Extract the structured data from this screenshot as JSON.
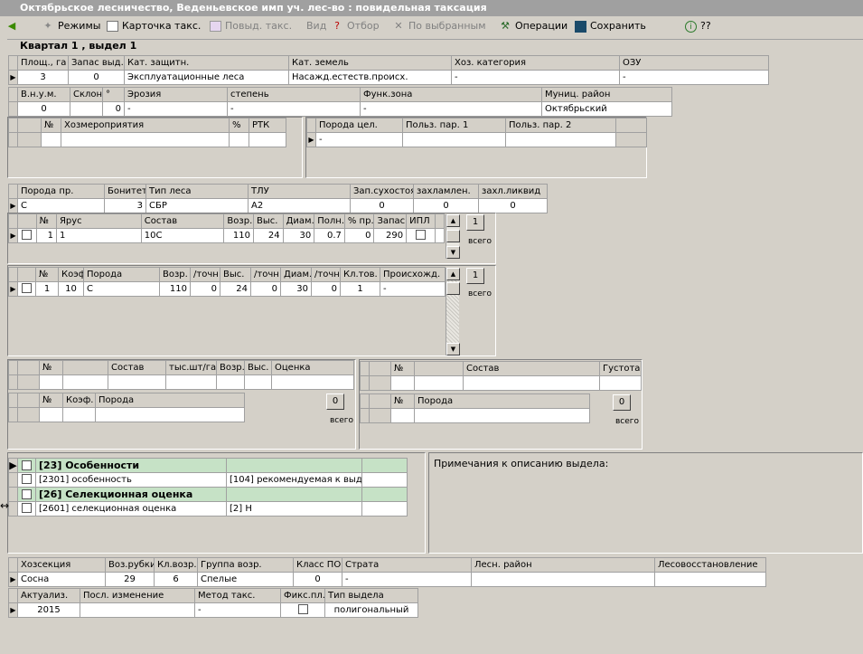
{
  "window": {
    "title": "Октябрьское лесничество, Веденьевское имп уч. лес-во : повидельная таксация"
  },
  "toolbar": {
    "rezhimy": "Режимы",
    "kartochka": "Карточка такс.",
    "povid": "Повыд. такс.",
    "vid": "Вид",
    "otbor": "Отбор",
    "po_vybrannym": "По выбранным",
    "operacii": "Операции",
    "sohranit": "Сохранить",
    "help": "??"
  },
  "quarter_label": "Квартал 1 , выдел 1",
  "grid1": {
    "headers": [
      "Площ., га",
      "Запас выд.",
      "Кат. защитн.",
      "Кат. земель",
      "Хоз. категория",
      "ОЗУ"
    ],
    "row": [
      "3",
      "0",
      "Эксплуатационные леса",
      "Насажд.естеств.происх.",
      "-",
      "-"
    ]
  },
  "grid2": {
    "headers": [
      "В.н.у.м.",
      "Склон",
      "°",
      "Эрозия",
      "степень",
      "Функ.зона",
      "Муниц. район"
    ],
    "row": [
      "0",
      "",
      "0",
      "-",
      "-",
      "-",
      "Октябрьский"
    ]
  },
  "grid3": {
    "headers": [
      "№",
      "Хозмероприятия",
      "%",
      "РТК"
    ]
  },
  "grid4": {
    "headers": [
      "Порода цел.",
      "Польз. пар. 1",
      "Польз. пар. 2"
    ],
    "row": [
      "-",
      "",
      ""
    ]
  },
  "grid5": {
    "headers": [
      "Порода пр.",
      "Бонитет",
      "Тип леса",
      "ТЛУ",
      "Зап.сухостоя",
      "захламлен.",
      "захл.ликвид"
    ],
    "row": [
      "С",
      "3",
      "СБР",
      "А2",
      "0",
      "0",
      "0"
    ]
  },
  "grid6": {
    "headers": [
      "№",
      "Ярус",
      "Состав",
      "Возр.",
      "Выс.",
      "Диам.",
      "Полн.",
      "% пр.",
      "Запас",
      "ИПЛ"
    ],
    "row": [
      "1",
      "1",
      "10С",
      "110",
      "24",
      "30",
      "0.7",
      "0",
      "290",
      ""
    ],
    "count": "1",
    "count_label": "всего"
  },
  "grid7": {
    "headers": [
      "№",
      "Коэф.",
      "Порода",
      "Возр.",
      "/точн",
      "Выс.",
      "/точн",
      "Диам.",
      "/точн",
      "Кл.тов.",
      "Происхожд."
    ],
    "row": [
      "1",
      "10",
      "С",
      "110",
      "0",
      "24",
      "0",
      "30",
      "0",
      "1",
      "-"
    ],
    "count": "1",
    "count_label": "всего"
  },
  "grid8": {
    "headers": [
      "№",
      "",
      "Состав",
      "тыс.шт/га",
      "Возр.",
      "Выс.",
      "Оценка"
    ]
  },
  "grid9": {
    "headers": [
      "№",
      "Коэф.",
      "Порода"
    ],
    "count": "0",
    "count_label": "всего"
  },
  "grid10": {
    "headers": [
      "№",
      "",
      "Состав",
      "Густота"
    ]
  },
  "grid11": {
    "headers": [
      "№",
      "Порода"
    ],
    "count": "0",
    "count_label": "всего"
  },
  "features": [
    {
      "label": "[23] Особенности",
      "value": "",
      "group": true
    },
    {
      "label": "[2301] особенность",
      "value": "[104] рекомендуемая к выде...",
      "group": false
    },
    {
      "label": "[26] Селекционная оценка",
      "value": "",
      "group": true
    },
    {
      "label": "[2601] селекционная оценка",
      "value": "[2] Н",
      "group": false
    }
  ],
  "notes_label": "Примечания к описанию выдела:",
  "grid12": {
    "headers": [
      "Хозсекция",
      "Воз.рубки",
      "Кл.возр.",
      "Группа возр.",
      "Класс ПО",
      "Страта",
      "Лесн. район",
      "Лесовосстановление"
    ],
    "row": [
      "Сосна",
      "29",
      "6",
      "Спелые",
      "0",
      "-",
      "",
      ""
    ]
  },
  "grid13": {
    "headers": [
      "Актуализ.",
      "Посл. изменение",
      "Метод такс.",
      "Фикс.пл.",
      "Тип выдела"
    ],
    "row": [
      "2015",
      "",
      "-",
      "",
      "полигональный"
    ]
  },
  "colors": {
    "group_row": "#c6e2c6",
    "titlebar": "#a0a0a0",
    "background": "#d4d0c8"
  }
}
